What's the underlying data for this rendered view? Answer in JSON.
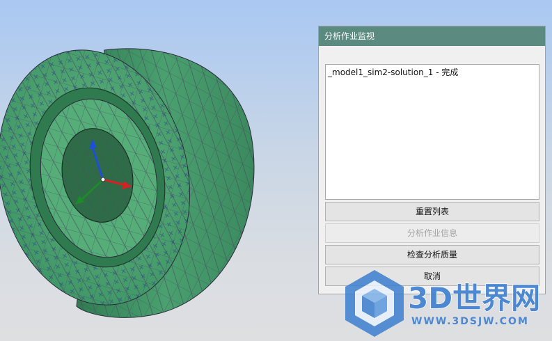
{
  "viewport": {
    "model_color": "#3f9e6a",
    "mesh_color": "#4b4b63",
    "marker_color": "#2a3a8f"
  },
  "dialog": {
    "title": "分析作业监视",
    "jobs": [
      "_model1_sim2-solution_1 - 完成"
    ],
    "buttons": {
      "reset_list": "重置列表",
      "job_info": "分析作业信息",
      "check_quality": "检查分析质量",
      "cancel": "取消"
    }
  },
  "watermark": {
    "brand": "3D世界网",
    "url": "WWW.3DSJW.COM",
    "colors": {
      "blue": "#3d7fd0",
      "light_blue": "#7fb3ea"
    }
  }
}
